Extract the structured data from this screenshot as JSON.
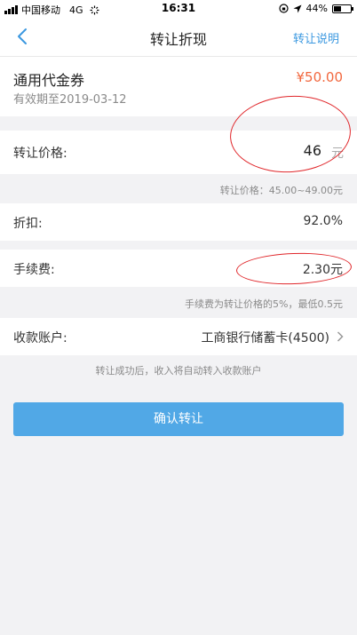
{
  "status_bar": {
    "carrier": "中国移动",
    "network": "4G",
    "time": "16:31",
    "battery": "44%",
    "battery_level": 0.44
  },
  "nav": {
    "title": "转让折现",
    "action": "转让说明",
    "back_icon": "chevron-left-icon"
  },
  "coupon": {
    "name": "通用代金券",
    "amount": "¥50.00",
    "validity": "有效期至2019-03-12"
  },
  "price": {
    "label": "转让价格:",
    "value": "46",
    "unit": "元",
    "hint": "转让价格：45.00~49.00元"
  },
  "discount": {
    "label": "折扣:",
    "value": "92.0%"
  },
  "fee": {
    "label": "手续费:",
    "value": "2.30元",
    "hint": "手续费为转让价格的5%，最低0.5元"
  },
  "account": {
    "label": "收款账户:",
    "value": "工商银行储蓄卡(4500)"
  },
  "notice": "转让成功后，收入将自动转入收款账户",
  "confirm_button": "确认转让",
  "colors": {
    "accent": "#3b98e0",
    "button": "#51a8e6",
    "price": "#f2683f",
    "annotation": "#e0262a"
  }
}
